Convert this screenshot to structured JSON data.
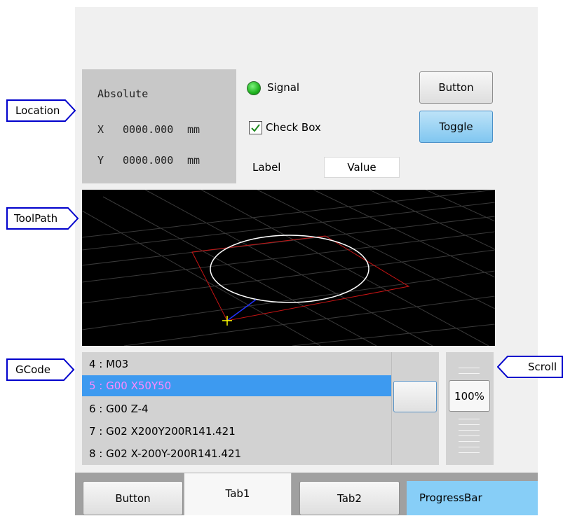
{
  "callouts": {
    "location": "Location",
    "toolpath": "ToolPath",
    "gcode": "GCode",
    "scroll": "Scroll"
  },
  "location": {
    "title": "Absolute",
    "x_axis": "X",
    "x_value": "0000.000",
    "x_unit": "mm",
    "y_axis": "Y",
    "y_value": "0000.000",
    "y_unit": "mm"
  },
  "controls": {
    "signal_label": "Signal",
    "signal_color": "#1fb21f",
    "checkbox_label": "Check Box",
    "checkbox_checked": true,
    "label_text": "Label",
    "value_text": "Value",
    "button_label": "Button",
    "toggle_label": "Toggle"
  },
  "gcode": {
    "lines": [
      "4 : M03",
      "5 : G00 X50Y50",
      "6 : G00 Z-4",
      "7 : G02 X200Y200R141.421",
      "8 : G02 X-200Y-200R141.421"
    ],
    "selected_index": 1
  },
  "zoom": {
    "label": "100%"
  },
  "bottom": {
    "button_label": "Button",
    "tab1_label": "Tab1",
    "tab2_label": "Tab2",
    "progress_label": "ProgressBar",
    "progress_color": "#87cef7"
  },
  "colors": {
    "highlight": "#3d9af0",
    "selected_text": "#ff88ff",
    "toggle": "#80c6f0",
    "callout_border": "#0000cc"
  }
}
